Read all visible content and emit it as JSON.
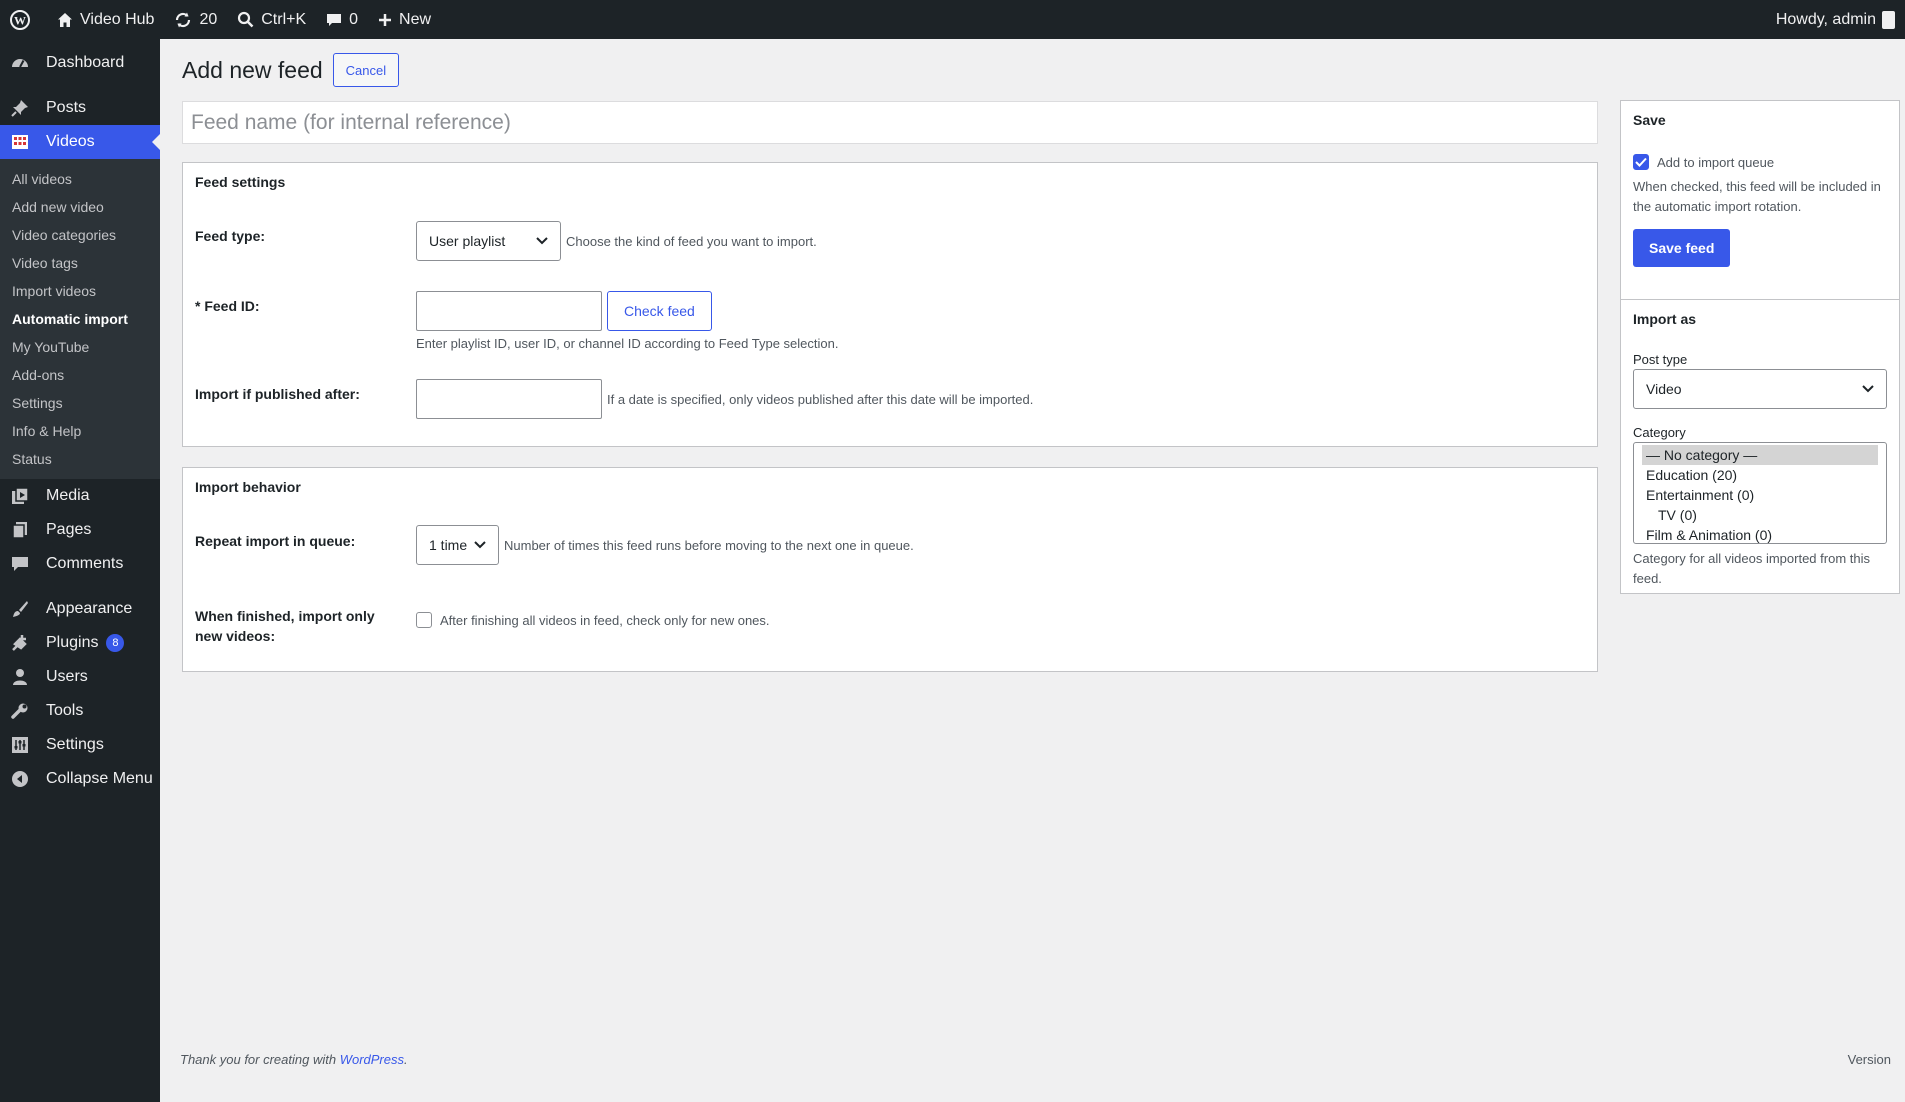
{
  "adminbar": {
    "site_name": "Video Hub",
    "updates_count": "20",
    "search_shortcut": "Ctrl+K",
    "comments_count": "0",
    "new_label": "New",
    "howdy": "Howdy, admin"
  },
  "sidebar": {
    "dashboard": "Dashboard",
    "posts": "Posts",
    "videos": "Videos",
    "submenu": [
      "All videos",
      "Add new video",
      "Video categories",
      "Video tags",
      "Import videos",
      "Automatic import",
      "My YouTube",
      "Add-ons",
      "Settings",
      "Info & Help",
      "Status"
    ],
    "media": "Media",
    "pages": "Pages",
    "comments": "Comments",
    "appearance": "Appearance",
    "plugins": "Plugins",
    "plugins_badge": "8",
    "users": "Users",
    "tools": "Tools",
    "settings": "Settings",
    "collapse": "Collapse Menu"
  },
  "page": {
    "title": "Add new feed",
    "cancel_label": "Cancel",
    "feed_name_placeholder": "Feed name (for internal reference)"
  },
  "feed_settings": {
    "heading": "Feed settings",
    "feed_type_label": "Feed type:",
    "feed_type_value": "User playlist",
    "feed_type_desc": "Choose the kind of feed you want to import.",
    "feed_id_label": "* Feed ID:",
    "check_feed_label": "Check feed",
    "feed_id_desc": "Enter playlist ID, user ID, or channel ID according to Feed Type selection.",
    "published_after_label": "Import if published after:",
    "published_after_desc": "If a date is specified, only videos published after this date will be imported."
  },
  "import_behavior": {
    "heading": "Import behavior",
    "repeat_label": "Repeat import in queue:",
    "repeat_value": "1 time",
    "repeat_desc": "Number of times this feed runs before moving to the next one in queue.",
    "finished_label": "When finished, import only new videos:",
    "finished_desc": "After finishing all videos in feed, check only for new ones."
  },
  "save_box": {
    "heading": "Save",
    "queue_label": "Add to import queue",
    "queue_desc": "When checked, this feed will be included in the automatic import rotation.",
    "save_label": "Save feed"
  },
  "import_as_box": {
    "heading": "Import as",
    "post_type_label": "Post type",
    "post_type_value": "Video",
    "category_label": "Category",
    "categories": [
      "— No category —",
      "Education (20)",
      "Entertainment (0)",
      "TV (0)",
      "Film & Animation (0)"
    ],
    "category_desc": "Category for all videos imported from this feed."
  },
  "footer": {
    "thanks_prefix": "Thank you for creating with ",
    "wordpress_link": "WordPress",
    "thanks_suffix": ".",
    "version": "Version"
  },
  "colors": {
    "accent": "#3858e9",
    "adminbar_bg": "#1d2327",
    "submenu_bg": "#2c3338",
    "page_bg": "#f0f0f1"
  }
}
